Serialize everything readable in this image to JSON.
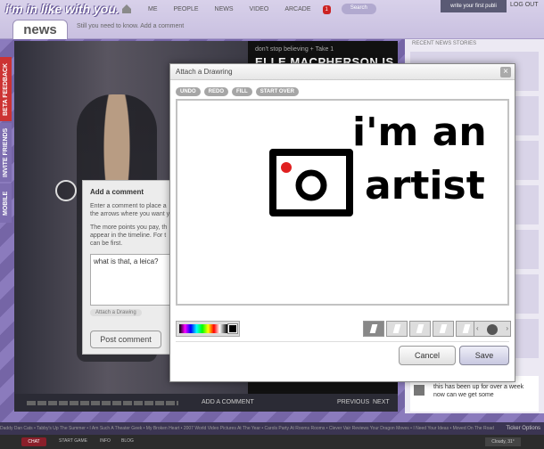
{
  "header": {
    "logo_text": "i'm in like with you.",
    "section_tab": "news",
    "subtitle": "Still you need to know. Add a comment",
    "nav": [
      "ME",
      "PEOPLE",
      "NEWS",
      "VIDEO",
      "ARCADE"
    ],
    "notification_count": "1",
    "search_label": "Search",
    "write_button": "write your first publi",
    "logout": "LOG OUT"
  },
  "side_tabs": {
    "beta": "BETA FEEDBACK",
    "invite": "INVITE FRIENDS",
    "mobile": "MOBILE"
  },
  "video": {
    "kicker": "don't stop believing + Take 1",
    "headline": "ELLE MACPHERSON IS",
    "add_comment": "ADD A COMMENT",
    "previous": "PREVIOUS",
    "next": "NEXT"
  },
  "comment_panel": {
    "title": "Add a comment",
    "text1": "Enter a comment to place a the arrows where you want y",
    "text2": "The more points you pay, th appear in the timeline. For t can be first.",
    "input_value": "what is that, a leica?",
    "attach_label": "Attach a Drawing",
    "post_button": "Post comment"
  },
  "right_column": {
    "title": "RECENT NEWS STORIES",
    "comment_text": "this has been up for over a week now can we get some"
  },
  "ticker": {
    "text": "Daddy Dan Cats • Tabby's Up The Summer • I Am Such A Theater Geek • My Broken Heart • 2007 World Video Pictures At The Year • Carols Party At Rooms Rooms • Clever Vair Reviews Your Dragon Moves • I Need Your Ideas • Moved On The Road",
    "options": "Ticker Options"
  },
  "statusbar": {
    "chat": "CHAT",
    "items": [
      "START GAME",
      "INFO",
      "BLOG"
    ],
    "weather": "Cloudy, 31°"
  },
  "dialog": {
    "title": "Attach a Drawring",
    "close": "×",
    "toolbar": [
      "UNDO",
      "REDO",
      "FILL",
      "START OVER"
    ],
    "cancel": "Cancel",
    "save": "Save",
    "drawing_text_1": "i'm an",
    "drawing_text_2": "artist",
    "selected_color": "#000000",
    "accent_red": "#e02020"
  }
}
